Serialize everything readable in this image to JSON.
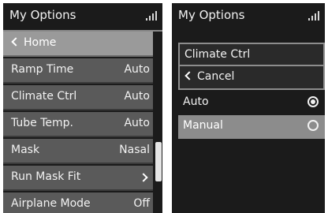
{
  "colors": {
    "screen_bg": "#1b1b1b",
    "row_bg": "#5a5a5a",
    "header_row_bg": "#9a9a9a",
    "selected_row_bg": "#8c8c8c",
    "text": "#f2f2f2"
  },
  "left": {
    "title": "My Options",
    "signal_icon": "signal-bars-icon",
    "back_label": "Home",
    "items": [
      {
        "label": "Ramp Time",
        "value": "Auto"
      },
      {
        "label": "Climate Ctrl",
        "value": "Auto"
      },
      {
        "label": "Tube Temp.",
        "value": "Auto"
      },
      {
        "label": "Mask",
        "value": "Nasal"
      },
      {
        "label": "Run Mask Fit",
        "value": ""
      },
      {
        "label": "Airplane Mode",
        "value": "Off"
      }
    ]
  },
  "right": {
    "title": "My Options",
    "signal_icon": "signal-bars-icon",
    "section_label": "Climate Ctrl",
    "cancel_label": "Cancel",
    "options": [
      {
        "label": "Auto",
        "checked": true
      },
      {
        "label": "Manual",
        "checked": false
      }
    ]
  }
}
